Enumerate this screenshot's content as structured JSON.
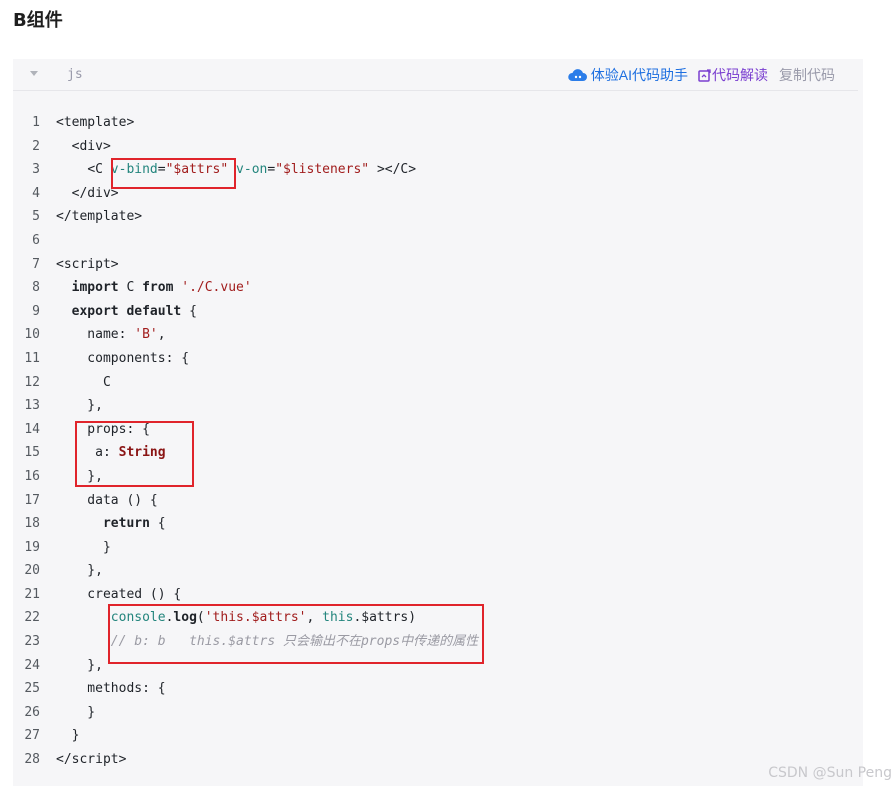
{
  "heading": "B组件",
  "toolbar": {
    "language": "js",
    "ai_assistant_label": "体验AI代码助手",
    "explain_label": "代码解读",
    "copy_label": "复制代码"
  },
  "code_lines": [
    {
      "n": "1",
      "html": "<span class=\"tag\">&lt;template&gt;</span>"
    },
    {
      "n": "2",
      "html": "  <span class=\"tag\">&lt;div&gt;</span>"
    },
    {
      "n": "3",
      "html": "    <span class=\"tag\">&lt;C</span> <span class=\"attr\">v-bind</span>=<span class=\"str\">\"$attrs\"</span> <span class=\"attr\">v-on</span>=<span class=\"str\">\"$listeners\"</span> <span class=\"tag\">&gt;&lt;/C&gt;</span>"
    },
    {
      "n": "4",
      "html": "  <span class=\"tag\">&lt;/div&gt;</span>"
    },
    {
      "n": "5",
      "html": "<span class=\"tag\">&lt;/template&gt;</span>"
    },
    {
      "n": "6",
      "html": ""
    },
    {
      "n": "7",
      "html": "<span class=\"tag\">&lt;script&gt;</span>"
    },
    {
      "n": "8",
      "html": "  <span class=\"kw\">import</span> C <span class=\"kw\">from</span> <span class=\"str\">'./C.vue'</span>"
    },
    {
      "n": "9",
      "html": "  <span class=\"kw\">export</span> <span class=\"kw\">default</span> {"
    },
    {
      "n": "10",
      "html": "    name: <span class=\"str\">'B'</span>,"
    },
    {
      "n": "11",
      "html": "    components: {"
    },
    {
      "n": "12",
      "html": "      C"
    },
    {
      "n": "13",
      "html": "    },"
    },
    {
      "n": "14",
      "html": "    props: {"
    },
    {
      "n": "15",
      "html": "     a: <span class=\"type\">String</span>"
    },
    {
      "n": "16",
      "html": "    },"
    },
    {
      "n": "17",
      "html": "    data () {"
    },
    {
      "n": "18",
      "html": "      <span class=\"kw\">return</span> {"
    },
    {
      "n": "19",
      "html": "      }"
    },
    {
      "n": "20",
      "html": "    },"
    },
    {
      "n": "21",
      "html": "    created () {"
    },
    {
      "n": "22",
      "html": "       <span class=\"obj\">console</span>.<span class=\"fn\">log</span>(<span class=\"str\">'this.$attrs'</span>, <span class=\"obj\">this</span>.$attrs)"
    },
    {
      "n": "23",
      "html": "       <span class=\"cmt\">// b: b   this.$attrs 只会输出不在props中传递的属性</span>"
    },
    {
      "n": "24",
      "html": "    },"
    },
    {
      "n": "25",
      "html": "    methods: {"
    },
    {
      "n": "26",
      "html": "    }"
    },
    {
      "n": "27",
      "html": "  }"
    },
    {
      "n": "28",
      "html": "<span class=\"tag\">&lt;/script&gt;</span>"
    }
  ],
  "watermark": "CSDN @Sun  Peng",
  "highlight_color": "#e0242b"
}
